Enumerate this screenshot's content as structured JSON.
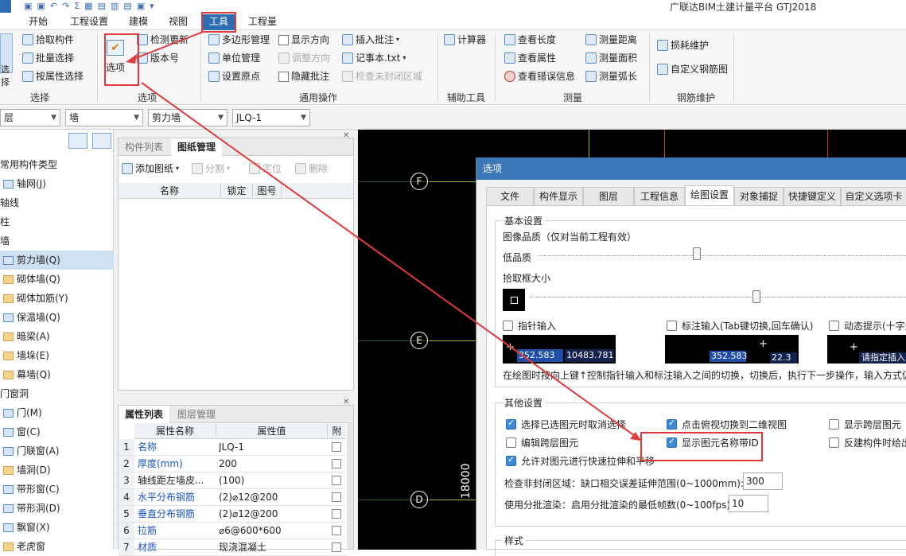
{
  "app": {
    "title": "广联达BIM土建计量平台 GTJ2018"
  },
  "ribbon_tabs": [
    "开始",
    "工程设置",
    "建模",
    "视图",
    "工具",
    "工程量"
  ],
  "ribbon": {
    "select_group": {
      "label": "选择",
      "big_btn": "选择",
      "items": [
        "拾取构件",
        "批量选择",
        "按属性选择"
      ]
    },
    "options_group": {
      "label": "选项",
      "big_btn": "选项",
      "items": [
        "检测更新",
        "版本号"
      ]
    },
    "general_group": {
      "label": "通用操作",
      "col1": [
        "多边形管理",
        "单位管理",
        "设置原点"
      ],
      "col2": [
        "显示方向",
        "调整方向",
        "隐藏批注"
      ],
      "col3": [
        "插入批注",
        "记事本.txt",
        "检查未封闭区域"
      ]
    },
    "aux_group": {
      "label": "辅助工具",
      "items": [
        "计算器"
      ]
    },
    "measure_group": {
      "label": "测量",
      "col1": [
        "查看长度",
        "查看属性",
        "查看错误信息"
      ],
      "col2": [
        "测量距离",
        "测量面积",
        "测量弧长"
      ]
    },
    "rebar_group": {
      "label": "钢筋维护",
      "items": [
        "损耗维护",
        "自定义钢筋图"
      ]
    }
  },
  "combos": [
    "层",
    "墙",
    "剪力墙",
    "JLQ-1"
  ],
  "tree": {
    "items": [
      "常用构件类型",
      "轴网(J)",
      "轴线",
      "柱",
      "墙",
      "剪力墙(Q)",
      "砌体墙(Q)",
      "砌体加筋(Y)",
      "保温墙(Q)",
      "暗梁(A)",
      "墙垛(E)",
      "幕墙(Q)",
      "门窗洞",
      "门(M)",
      "窗(C)",
      "门联窗(A)",
      "墙洞(D)",
      "带形窗(C)",
      "带形洞(D)",
      "飘窗(X)",
      "老虎窗"
    ]
  },
  "drawing_panel": {
    "tabs": [
      "构件列表",
      "图纸管理"
    ],
    "toolbar": [
      "添加图纸",
      "分割",
      "定位",
      "删除"
    ],
    "columns": [
      "名称",
      "锁定",
      "图号"
    ]
  },
  "property_panel": {
    "tabs": [
      "属性列表",
      "图层管理"
    ],
    "columns": [
      "属性名称",
      "属性值",
      "附"
    ],
    "rows": [
      {
        "n": "1",
        "name": "名称",
        "value": "JLQ-1"
      },
      {
        "n": "2",
        "name": "厚度(mm)",
        "value": "200"
      },
      {
        "n": "3",
        "name": "轴线距左墙皮...",
        "value": "(100)"
      },
      {
        "n": "4",
        "name": "水平分布钢筋",
        "value": "(2)⌀12@200"
      },
      {
        "n": "5",
        "name": "垂直分布钢筋",
        "value": "(2)⌀12@200"
      },
      {
        "n": "6",
        "name": "拉筋",
        "value": "⌀6@600*600"
      },
      {
        "n": "7",
        "name": "材质",
        "value": "现浇混凝土"
      }
    ]
  },
  "canvas": {
    "axes": [
      "F",
      "E",
      "D"
    ],
    "dimension": "18000"
  },
  "dialog": {
    "title": "选项",
    "tabs": [
      "文件",
      "构件显示",
      "图层",
      "工程信息",
      "绘图设置",
      "对象捕捉",
      "快捷键定义",
      "自定义选项卡"
    ],
    "basic": {
      "legend": "基本设置",
      "quality_label": "图像品质（仅对当前工程有效）",
      "low_label": "低品质",
      "quality_level": 0.43,
      "pick_label": "拾取框大小",
      "pick_level": 0.6,
      "pointer_input": "指针输入",
      "dim_input": "标注输入(Tab键切换,回车确认)",
      "dynamic_hint": "动态提示(十字光",
      "preview1_a": "352.583",
      "preview1_b": "10483.781",
      "preview2_a": "352.583",
      "preview2_b": "22.3",
      "preview3": "请指定插入",
      "note": "在绘图时按向上键↑控制指针输入和标注输入之间的切换，切换后，执行下一步操作，输入方式仍"
    },
    "other": {
      "legend": "其他设置",
      "c1": "选择已选图元时取消选择",
      "c2": "点击俯视切换到二维视图",
      "c3": "显示跨层图元",
      "c4": "编辑跨层图元",
      "c5": "显示图元名称带ID",
      "c6": "反建构件时给出",
      "c7": "允许对图元进行快速拉伸和平移",
      "check_label": "检查非封闭区域：缺口相交误差延伸范围(0~1000mm):",
      "check_value": "300",
      "batch_label": "使用分批渲染：启用分批渲染的最低帧数(0~100fps):",
      "batch_value": "10"
    },
    "style_legend": "样式"
  }
}
